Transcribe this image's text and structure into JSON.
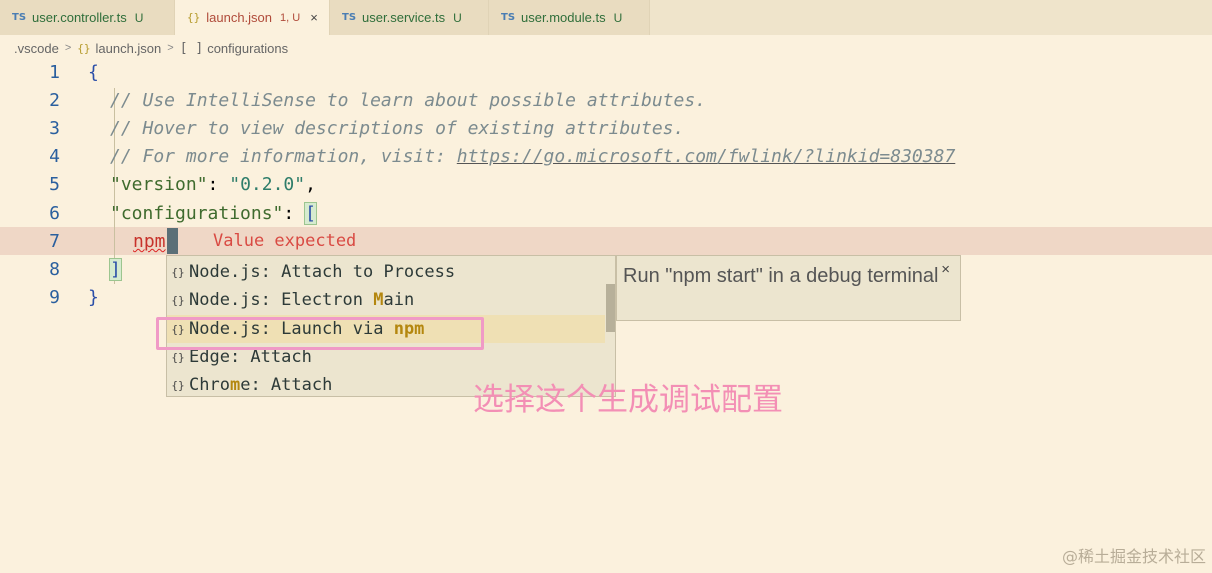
{
  "tabs": [
    {
      "icon": "TS",
      "label": "user.controller.ts",
      "status": "U"
    },
    {
      "icon": "{}",
      "label": "launch.json",
      "status": "1, U",
      "close": "×"
    },
    {
      "icon": "TS",
      "label": "user.service.ts",
      "status": "U"
    },
    {
      "icon": "TS",
      "label": "user.module.ts",
      "status": "U"
    }
  ],
  "breadcrumb": {
    "folder": ".vscode",
    "file_icon": "{}",
    "file": "launch.json",
    "symbol_icon": "[ ]",
    "symbol": "configurations",
    "chevron": ">"
  },
  "line_numbers": [
    "1",
    "2",
    "3",
    "4",
    "5",
    "6",
    "7",
    "8",
    "9"
  ],
  "code": {
    "l1_brace": "{",
    "l2_comment": "// Use IntelliSense to learn about possible attributes.",
    "l3_comment": "// Hover to view descriptions of existing attributes.",
    "l4_comment_prefix": "// For more information, visit: ",
    "l4_url": "https://go.microsoft.com/fwlink/?linkid=830387",
    "l5_key": "\"version\"",
    "l5_colon": ": ",
    "l5_value": "\"0.2.0\"",
    "l5_comma": ",",
    "l6_key": "\"configurations\"",
    "l6_colon": ": ",
    "l6_bracket": "[",
    "l7_text": "npm",
    "l8_bracket": "]",
    "l9_brace": "}"
  },
  "error_message": "Value expected",
  "suggestions": [
    {
      "icon": "{}",
      "pre": "Node.js: Attach to Process",
      "hl": "",
      "post": ""
    },
    {
      "icon": "{}",
      "pre": "Node.js: Electron ",
      "hl": "M",
      "post": "ain"
    },
    {
      "icon": "{}",
      "pre": "Node.js: Launch via ",
      "hl": "npm",
      "post": ""
    },
    {
      "icon": "{}",
      "pre": "Edge: Attach",
      "hl": "",
      "post": ""
    },
    {
      "icon": "{}",
      "pre": "Chro",
      "hl": "m",
      "post": "e: Attach"
    }
  ],
  "detail": {
    "text": "Run \"npm start\" in a debug terminal",
    "close": "×"
  },
  "annotation": "选择这个生成调试配置",
  "watermark": "@稀土掘金技术社区",
  "colors": {
    "background": "#fbf1dd",
    "annotation_pink": "#f09ac6",
    "error_red": "#d94a43"
  }
}
